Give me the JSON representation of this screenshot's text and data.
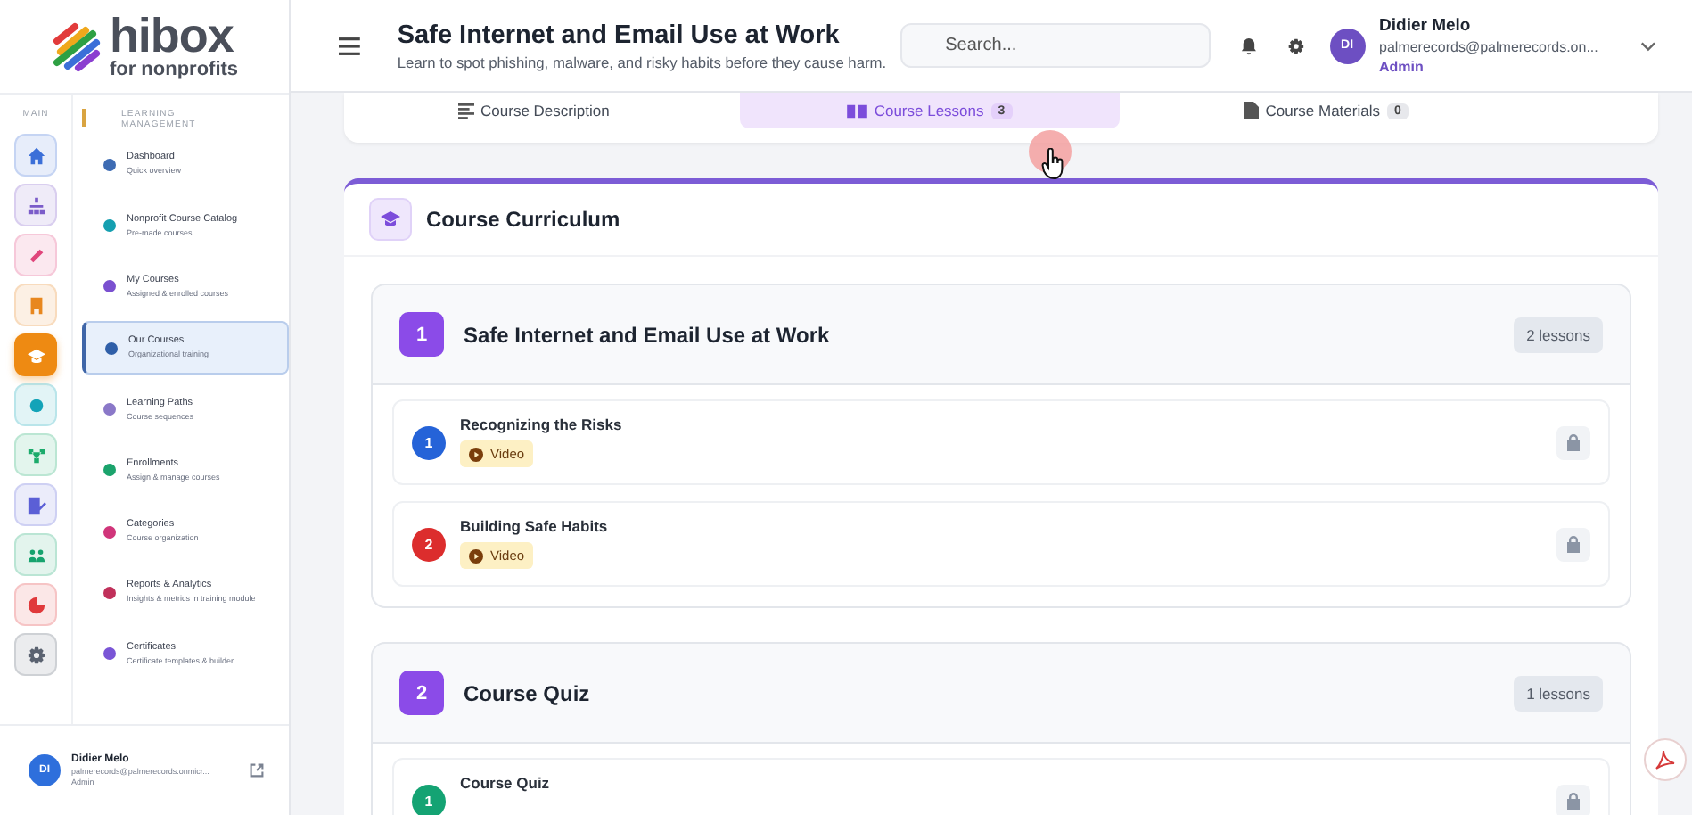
{
  "logo": {
    "name": "hibox",
    "tagline": "for nonprofits"
  },
  "rail": {
    "label": "MAIN",
    "items": [
      {
        "color": "#3b6fd8",
        "selected": false
      },
      {
        "color": "#7b5cc9",
        "selected": false
      },
      {
        "color": "#e0457b",
        "selected": false
      },
      {
        "color": "#e8871e",
        "selected": false
      },
      {
        "color": "#ee8a12",
        "selected": true
      },
      {
        "color": "#13a3b8",
        "selected": false
      },
      {
        "color": "#1bab6b",
        "selected": false
      },
      {
        "color": "#5b5fd6",
        "selected": false
      },
      {
        "color": "#16a36e",
        "selected": false
      },
      {
        "color": "#e0393b",
        "selected": false
      },
      {
        "color": "#5a6270",
        "selected": false
      }
    ]
  },
  "menu": {
    "label": "LEARNING MANAGEMENT",
    "items": [
      {
        "title": "Dashboard",
        "subtitle": "Quick overview",
        "color": "#3d6bb3",
        "selected": false
      },
      {
        "title": "Nonprofit Course Catalog",
        "subtitle": "Pre-made courses",
        "color": "#159fb0",
        "selected": false
      },
      {
        "title": "My Courses",
        "subtitle": "Assigned & enrolled courses",
        "color": "#7a50d0",
        "selected": false
      },
      {
        "title": "Our Courses",
        "subtitle": "Organizational training",
        "color": "#2f5fa8",
        "selected": true
      },
      {
        "title": "Learning Paths",
        "subtitle": "Course sequences",
        "color": "#8a78c8",
        "selected": false
      },
      {
        "title": "Enrollments",
        "subtitle": "Assign & manage courses",
        "color": "#1ba36c",
        "selected": false
      },
      {
        "title": "Categories",
        "subtitle": "Course organization",
        "color": "#d0357a",
        "selected": false
      },
      {
        "title": "Reports & Analytics",
        "subtitle": "Insights & metrics in training module",
        "color": "#c0305a",
        "selected": false
      },
      {
        "title": "Certificates",
        "subtitle": "Certificate templates & builder",
        "color": "#7a55d6",
        "selected": false
      }
    ]
  },
  "sidebar_user": {
    "initials": "DI",
    "name": "Didier Melo",
    "email": "palmerecords@palmerecords.onmicr...",
    "role": "Admin"
  },
  "header": {
    "title": "Safe Internet and Email Use at Work",
    "subtitle": "Learn to spot phishing, malware, and risky habits before they cause harm.",
    "search": {
      "placeholder": "Search..."
    },
    "user": {
      "initials": "DI",
      "name": "Didier Melo",
      "email": "palmerecords@palmerecords.on...",
      "role": "Admin"
    }
  },
  "tabs": [
    {
      "label": "Course Description",
      "selected": false
    },
    {
      "label": "Course Lessons",
      "count": "3",
      "selected": true
    },
    {
      "label": "Course Materials",
      "count": "0",
      "selected": false
    }
  ],
  "curriculum": {
    "title": "Course Curriculum",
    "sections": [
      {
        "number": "1",
        "title": "Safe Internet and Email Use at Work",
        "count": "2 lessons",
        "lessons": [
          {
            "number": "1",
            "title": "Recognizing the Risks",
            "type": "Video",
            "color": "#2563d8"
          },
          {
            "number": "2",
            "title": "Building Safe Habits",
            "type": "Video",
            "color": "#dc2d2d"
          }
        ]
      },
      {
        "number": "2",
        "title": "Course Quiz",
        "count": "1 lessons",
        "lessons": [
          {
            "number": "1",
            "title": "Course Quiz",
            "color": "#14a373"
          }
        ]
      }
    ]
  }
}
